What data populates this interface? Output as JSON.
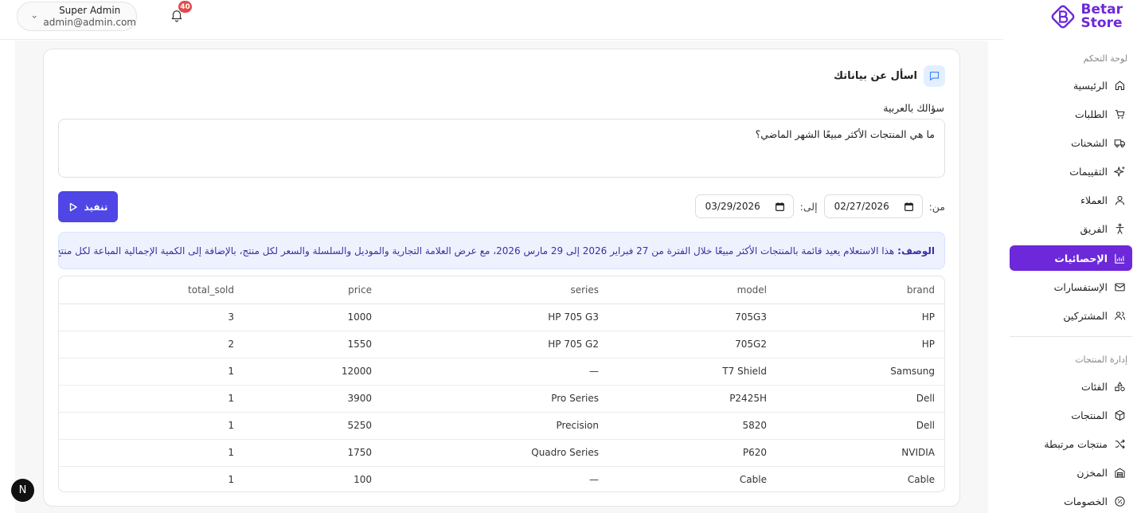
{
  "brand": {
    "name_line1": "Betar",
    "name_line2": "Store",
    "accent": "#6d28d9"
  },
  "user": {
    "name": "Super Admin",
    "email": "admin@admin.com"
  },
  "notifications": {
    "count": "40"
  },
  "sidebar": {
    "section1_title": "لوحة التحكم",
    "section2_title": "إدارة المنتجات",
    "items": [
      {
        "label": "الرئيسية",
        "icon": "home-icon"
      },
      {
        "label": "الطلبات",
        "icon": "cart-icon"
      },
      {
        "label": "الشحنات",
        "icon": "truck-icon"
      },
      {
        "label": "التقييمات",
        "icon": "sparkles-icon"
      },
      {
        "label": "العملاء",
        "icon": "user-icon"
      },
      {
        "label": "الفريق",
        "icon": "person-icon"
      },
      {
        "label": "الإحصائيات",
        "icon": "chart-icon",
        "active": true
      },
      {
        "label": "الإستفسارات",
        "icon": "mail-icon"
      },
      {
        "label": "المشتركين",
        "icon": "users-icon"
      },
      {
        "label": "الفئات",
        "icon": "shapes-icon"
      },
      {
        "label": "المنتجات",
        "icon": "package-icon"
      },
      {
        "label": "منتجات مرتبطة",
        "icon": "shuffle-icon"
      },
      {
        "label": "المخزن",
        "icon": "warehouse-icon"
      },
      {
        "label": "الخصومات",
        "icon": "discount-icon"
      }
    ]
  },
  "main": {
    "title": "اسأل عن بياناتك",
    "question_label": "سؤالك بالعربية",
    "question_value": "ما هي المنتجات الأكثر مبيعًا الشهر الماضي؟",
    "from_label": "من:",
    "to_label": "إلى:",
    "from_date": "02/27/2026",
    "to_date": "03/29/2026",
    "run_label": "تنفيذ",
    "description_label": "الوصف:",
    "description_text": "هذا الاستعلام يعيد قائمة بالمنتجات الأكثر مبيعًا خلال الفترة من 27 فبراير 2026 إلى 29 مارس 2026، مع عرض العلامة التجارية والموديل والسلسلة والسعر لكل منتج، بالإضافة إلى الكمية الإجمالية المباعة لكل منتج."
  },
  "table": {
    "columns": [
      "brand",
      "model",
      "series",
      "price",
      "total_sold"
    ],
    "rows": [
      [
        "HP",
        "705G3",
        "HP 705 G3",
        "1000",
        "3"
      ],
      [
        "HP",
        "705G2",
        "HP 705 G2",
        "1550",
        "2"
      ],
      [
        "Samsung",
        "T7 Shield",
        "—",
        "12000",
        "1"
      ],
      [
        "Dell",
        "P2425H",
        "Pro Series",
        "3900",
        "1"
      ],
      [
        "Dell",
        "5820",
        "Precision",
        "5250",
        "1"
      ],
      [
        "NVIDIA",
        "P620",
        "Quadro Series",
        "1750",
        "1"
      ],
      [
        "Cable",
        "Cable",
        "—",
        "100",
        "1"
      ]
    ]
  },
  "dev_badge": {
    "letter": "N"
  }
}
